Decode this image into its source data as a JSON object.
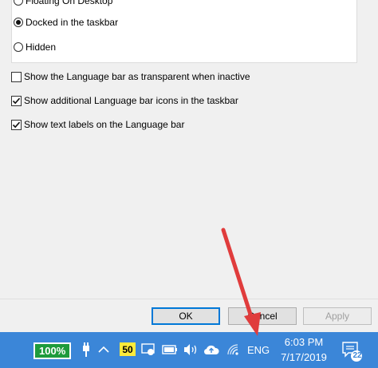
{
  "position_options": [
    {
      "label": "Floating On Desktop",
      "checked": false
    },
    {
      "label": "Docked in the taskbar",
      "checked": true
    },
    {
      "label": "Hidden",
      "checked": false
    }
  ],
  "checkboxes": [
    {
      "label": "Show the Language bar as transparent when inactive",
      "checked": false
    },
    {
      "label": "Show additional Language bar icons in the taskbar",
      "checked": true
    },
    {
      "label": "Show text labels on the Language bar",
      "checked": true
    }
  ],
  "buttons": {
    "ok": "OK",
    "cancel": "Cancel",
    "apply": "Apply"
  },
  "taskbar": {
    "battery_percent": "100%",
    "badge_value": "50",
    "language": "ENG",
    "time": "6:03 PM",
    "date": "7/17/2019",
    "notification_count": "22"
  },
  "colors": {
    "taskbar": "#3b86d8",
    "arrow": "#e03c3c",
    "battery": "#1e9b3c",
    "badge": "#ffeb3b"
  }
}
